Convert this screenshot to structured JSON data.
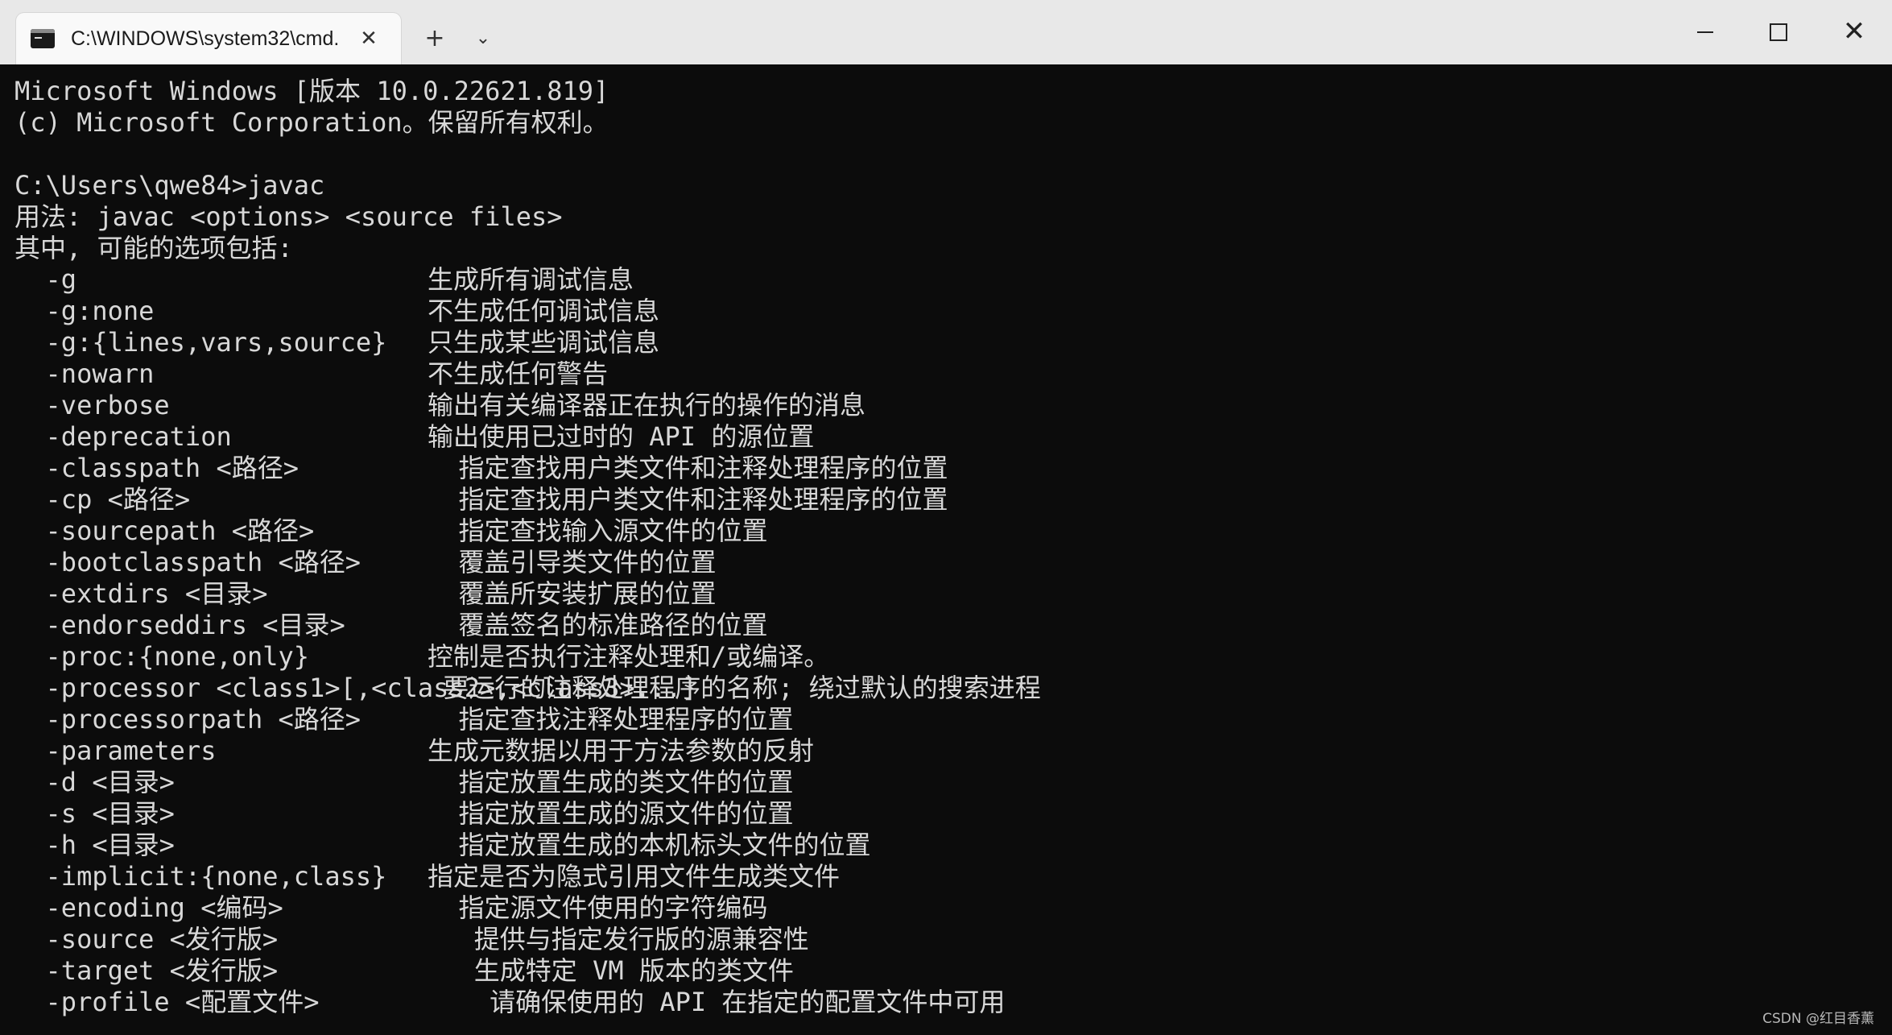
{
  "window": {
    "tab_title": "C:\\WINDOWS\\system32\\cmd.",
    "tab_close_glyph": "✕",
    "new_tab_glyph": "+",
    "dropdown_glyph": "⌄",
    "close_glyph": "✕"
  },
  "terminal": {
    "header_lines": [
      "Microsoft Windows [版本 10.0.22621.819]",
      "(c) Microsoft Corporation。保留所有权利。",
      "",
      "C:\\Users\\qwe84>javac",
      "用法: javac <options> <source files>",
      "其中, 可能的选项包括:"
    ],
    "options": [
      {
        "opt": "-g",
        "desc": "生成所有调试信息"
      },
      {
        "opt": "-g:none",
        "desc": "不生成任何调试信息"
      },
      {
        "opt": "-g:{lines,vars,source}",
        "desc": "只生成某些调试信息"
      },
      {
        "opt": "-nowarn",
        "desc": "不生成任何警告"
      },
      {
        "opt": "-verbose",
        "desc": "输出有关编译器正在执行的操作的消息"
      },
      {
        "opt": "-deprecation",
        "desc": "输出使用已过时的 API 的源位置"
      },
      {
        "opt": "-classpath <路径>",
        "desc": "  指定查找用户类文件和注释处理程序的位置"
      },
      {
        "opt": "-cp <路径>",
        "desc": "  指定查找用户类文件和注释处理程序的位置"
      },
      {
        "opt": "-sourcepath <路径>",
        "desc": "  指定查找输入源文件的位置"
      },
      {
        "opt": "-bootclasspath <路径>",
        "desc": "  覆盖引导类文件的位置"
      },
      {
        "opt": "-extdirs <目录>",
        "desc": "  覆盖所安装扩展的位置"
      },
      {
        "opt": "-endorseddirs <目录>",
        "desc": "  覆盖签名的标准路径的位置"
      },
      {
        "opt": "-proc:{none,only}",
        "desc": "控制是否执行注释处理和/或编译。"
      },
      {
        "opt": "-processor <class1>[,<class2>,<class3>...]",
        "desc": " 要运行的注释处理程序的名称; 绕过默认的搜索进程"
      },
      {
        "opt": "-processorpath <路径>",
        "desc": "  指定查找注释处理程序的位置"
      },
      {
        "opt": "-parameters",
        "desc": "生成元数据以用于方法参数的反射"
      },
      {
        "opt": "-d <目录>",
        "desc": "  指定放置生成的类文件的位置"
      },
      {
        "opt": "-s <目录>",
        "desc": "  指定放置生成的源文件的位置"
      },
      {
        "opt": "-h <目录>",
        "desc": "  指定放置生成的本机标头文件的位置"
      },
      {
        "opt": "-implicit:{none,class}",
        "desc": "指定是否为隐式引用文件生成类文件"
      },
      {
        "opt": "-encoding <编码>",
        "desc": "  指定源文件使用的字符编码"
      },
      {
        "opt": "-source <发行版>",
        "desc": "   提供与指定发行版的源兼容性"
      },
      {
        "opt": "-target <发行版>",
        "desc": "   生成特定 VM 版本的类文件"
      },
      {
        "opt": "-profile <配置文件>",
        "desc": "    请确保使用的 API 在指定的配置文件中可用"
      }
    ]
  },
  "watermark": "CSDN @红目香薰"
}
